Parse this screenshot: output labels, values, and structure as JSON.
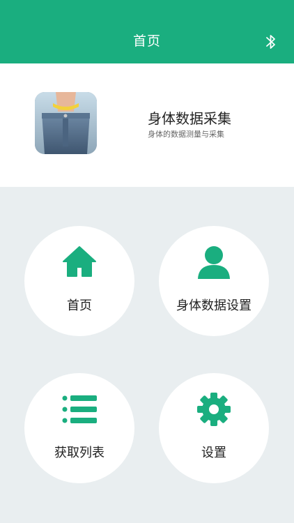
{
  "header": {
    "title": "首页",
    "bluetooth_icon": "bluetooth-icon"
  },
  "app": {
    "name": "身体数据采集",
    "subtitle": "身体的数据测量与采集",
    "icon": "waist-measure-icon"
  },
  "tiles": [
    {
      "label": "首页",
      "icon": "home-icon"
    },
    {
      "label": "身体数据设置",
      "icon": "user-icon"
    },
    {
      "label": "获取列表",
      "icon": "list-icon"
    },
    {
      "label": "设置",
      "icon": "gear-icon"
    }
  ],
  "colors": {
    "accent": "#1aae7f",
    "background": "#e9eef0",
    "card": "#ffffff"
  }
}
